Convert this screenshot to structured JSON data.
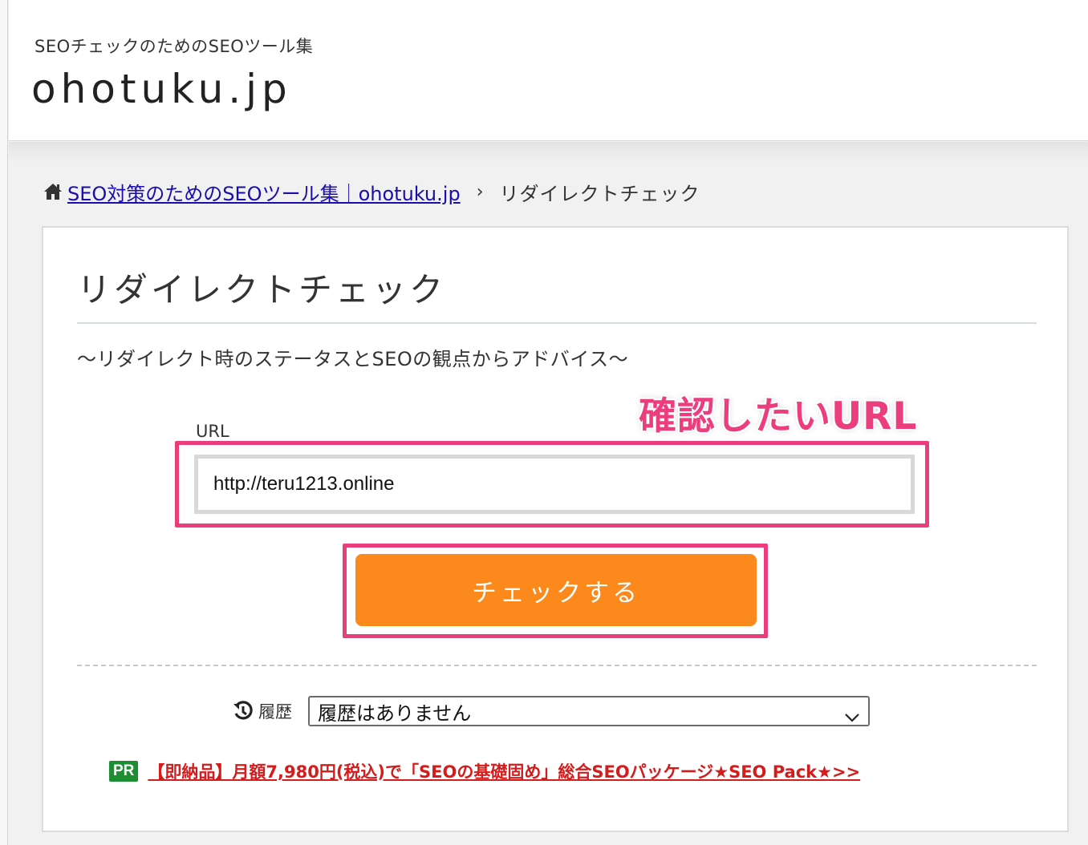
{
  "header": {
    "tagline": "SEOチェックのためのSEOツール集",
    "logo": "ohotuku.jp"
  },
  "breadcrumb": {
    "home_icon": "home-icon",
    "home_link": "SEO対策のためのSEOツール集｜ohotuku.jp",
    "separator": "›",
    "current": "リダイレクトチェック"
  },
  "main": {
    "title": "リダイレクトチェック",
    "subtitle": "～リダイレクト時のステータスとSEOの観点からアドバイス～",
    "annotation": "確認したいURL",
    "url_label": "URL",
    "url_value": "http://teru1213.online",
    "check_button": "チェックする",
    "highlight_color": "#ea3d7b",
    "button_color": "#fb891b"
  },
  "history": {
    "icon": "history-icon",
    "label": "履歴",
    "selected": "履歴はありません"
  },
  "promo": {
    "badge": "PR",
    "link_text": "【即納品】月額7,980円(税込)で「SEOの基礎固め」総合SEOパッケージ★SEO Pack★>>"
  }
}
